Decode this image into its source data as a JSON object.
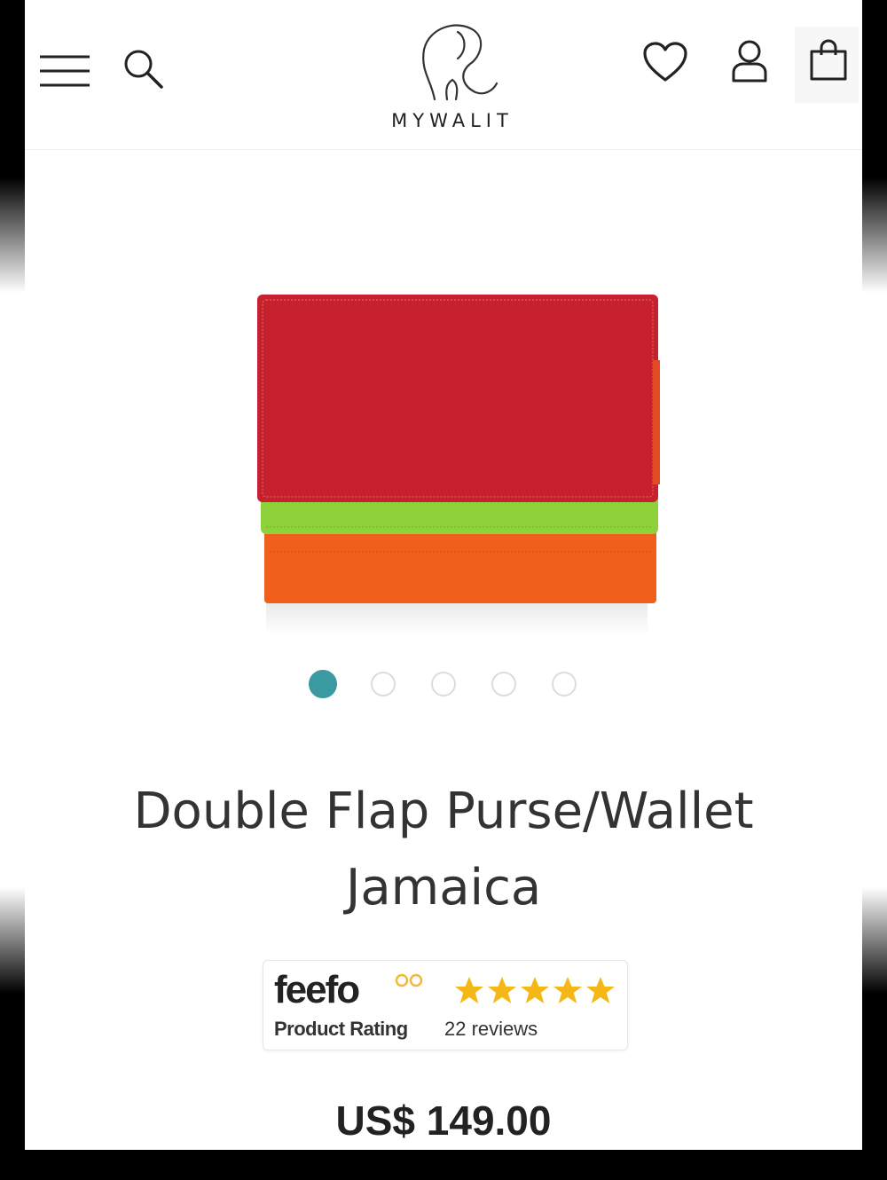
{
  "brand": {
    "name": "MYWALIT"
  },
  "header": {
    "icons": [
      "hamburger-menu-icon",
      "search-icon",
      "heart-icon",
      "user-icon",
      "shopping-bag-icon"
    ]
  },
  "product": {
    "title_line1": "Double Flap Purse/Wallet",
    "title_line2": "Jamaica",
    "price": "US$ 149.00",
    "colors": {
      "flap_red": "#c7202f",
      "middle_green": "#8fd13a",
      "bottom_orange": "#f0601c"
    }
  },
  "carousel": {
    "total_images": 5,
    "active_index": 0,
    "active_color": "#3a9aa0"
  },
  "feefo": {
    "logo_text": "feefo",
    "rating_label": "Product Rating",
    "review_count": "22 reviews",
    "stars": 5,
    "star_color": "#f5b716"
  }
}
